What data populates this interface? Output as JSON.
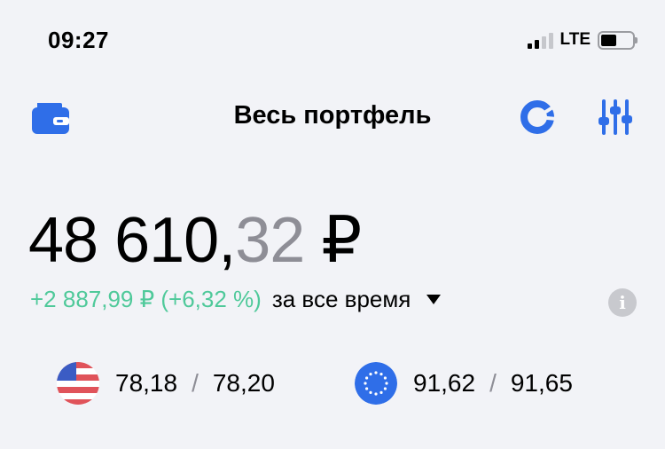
{
  "status_bar": {
    "time": "09:27",
    "network": "LTE"
  },
  "header": {
    "title": "Весь портфель"
  },
  "portfolio": {
    "amount_main": "48 610,",
    "amount_kop": "32",
    "currency_sign": "₽",
    "change": "+2 887,99 ₽ (+6,32 %)",
    "period": "за все время"
  },
  "rates": {
    "usd": {
      "buy": "78,18",
      "sell": "78,20",
      "separator": "/"
    },
    "eur": {
      "buy": "91,62",
      "sell": "91,65",
      "separator": "/"
    }
  },
  "colors": {
    "accent": "#2f6ee8",
    "positive": "#4fc99a",
    "muted": "#8e8e96"
  },
  "icons": [
    "wallet-icon",
    "pie-chart-icon",
    "sliders-icon",
    "info-icon",
    "us-flag-icon",
    "eu-flag-icon"
  ]
}
